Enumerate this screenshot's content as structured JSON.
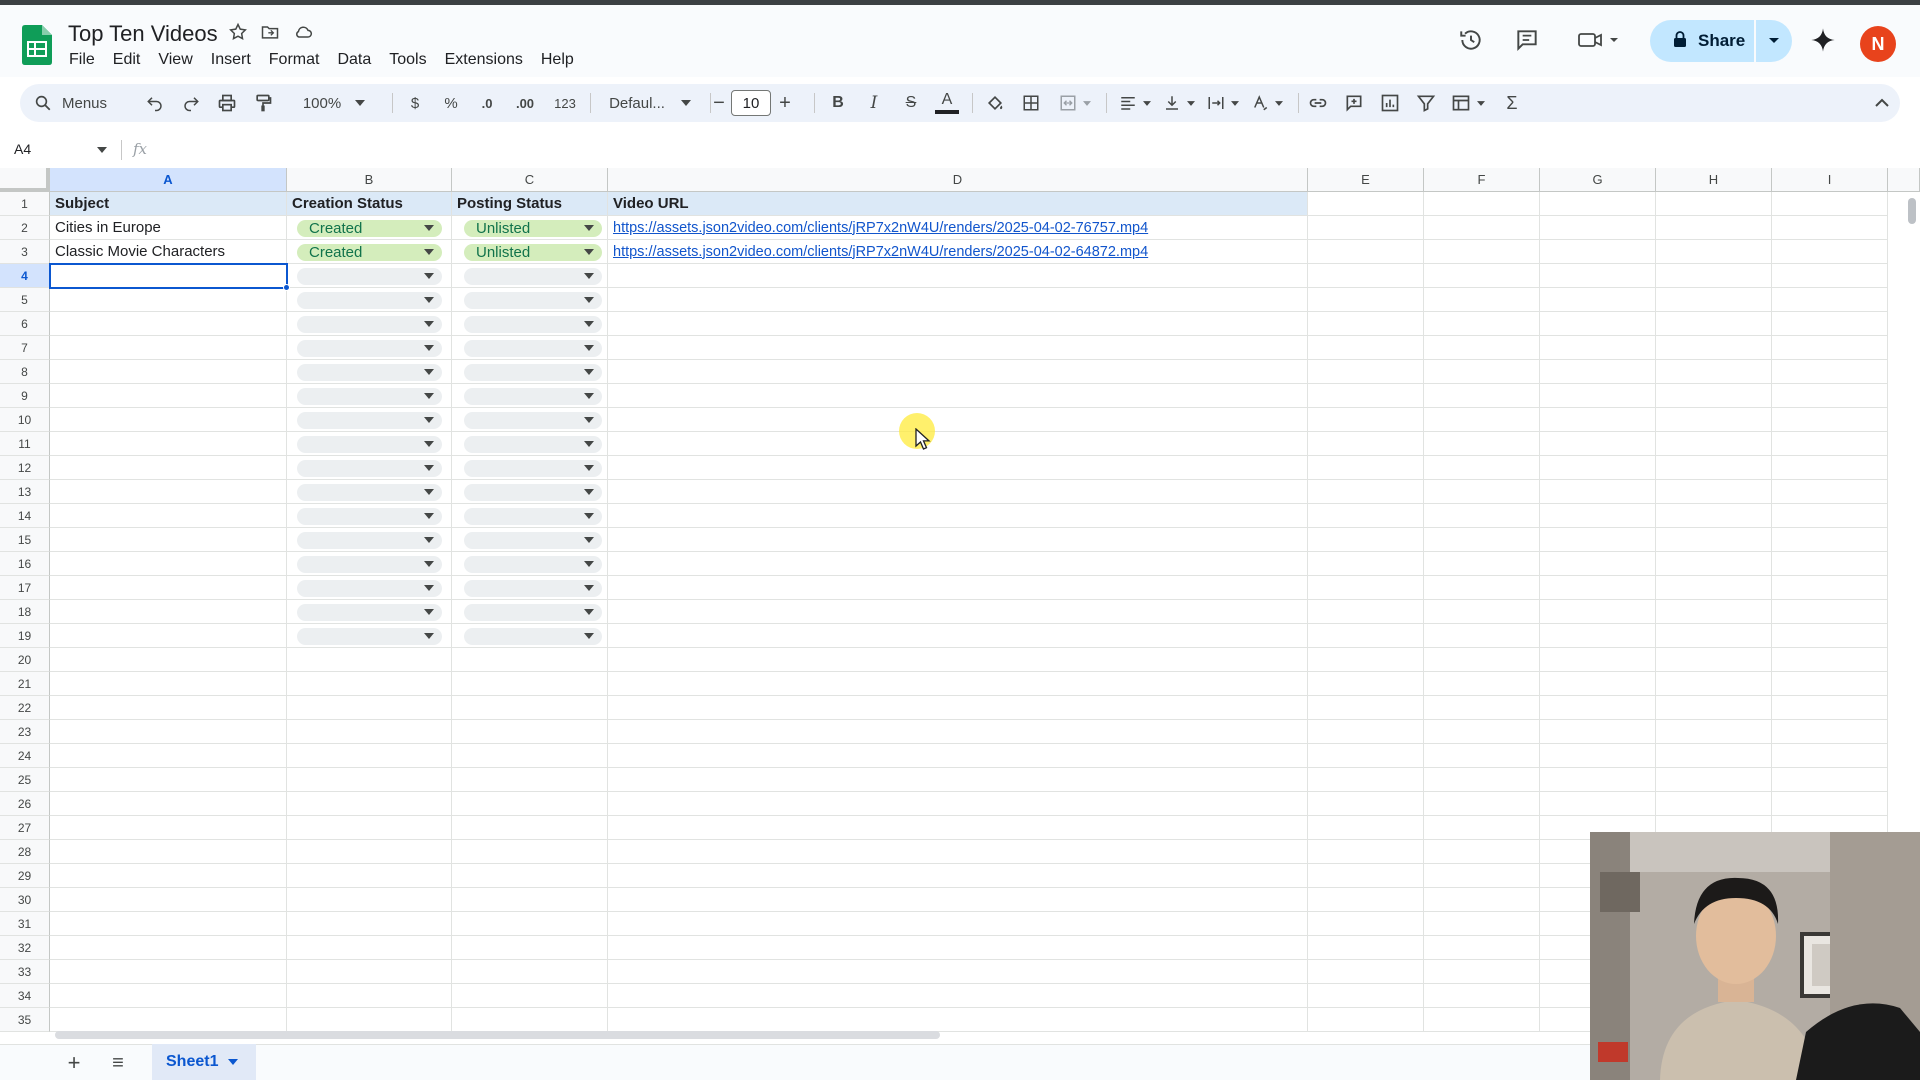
{
  "app": {
    "title": "Top Ten Videos",
    "menus": [
      "File",
      "Edit",
      "View",
      "Insert",
      "Format",
      "Data",
      "Tools",
      "Extensions",
      "Help"
    ],
    "share_label": "Share",
    "avatar_initial": "N"
  },
  "toolbar": {
    "menus_label": "Menus",
    "zoom": "100%",
    "currency": "$",
    "percent": "%",
    "dec_decrease": ".0",
    "dec_increase": ".00",
    "number_format": "123",
    "font": "Defaul...",
    "font_size": "10",
    "minus": "−",
    "plus": "+",
    "bold": "B",
    "italic": "I",
    "strike": "S",
    "text_color": "A",
    "sum": "Σ"
  },
  "formula_bar": {
    "name_box": "A4",
    "fx": "fx"
  },
  "columns": [
    "A",
    "B",
    "C",
    "D",
    "E",
    "F",
    "G",
    "H",
    "I"
  ],
  "headers": [
    "Subject",
    "Creation Status",
    "Posting Status",
    "Video URL"
  ],
  "rows": [
    {
      "subject": "Cities in Europe",
      "creation_status": "Created",
      "posting_status": "Unlisted",
      "url": "https://assets.json2video.com/clients/jRP7x2nW4U/renders/2025-04-02-76757.mp4"
    },
    {
      "subject": "Classic Movie Characters",
      "creation_status": "Created",
      "posting_status": "Unlisted",
      "url": "https://assets.json2video.com/clients/jRP7x2nW4U/renders/2025-04-02-64872.mp4"
    }
  ],
  "row_numbers": [
    "1",
    "2",
    "3",
    "4",
    "5",
    "6",
    "7",
    "8",
    "9",
    "10",
    "11",
    "12",
    "13",
    "14",
    "15",
    "16",
    "17",
    "18",
    "19",
    "20",
    "21",
    "22",
    "23",
    "24",
    "25",
    "26",
    "27",
    "28",
    "29",
    "30",
    "31",
    "32",
    "33",
    "34",
    "35"
  ],
  "sheet": {
    "add": "+",
    "list": "≡",
    "name": "Sheet1"
  },
  "colors": {
    "accent": "#0b57d0",
    "header_fill": "#dbe9f7",
    "chip_green": "#d4edbc",
    "share_bg": "#c2e7ff",
    "avatar": "#e8431c"
  }
}
